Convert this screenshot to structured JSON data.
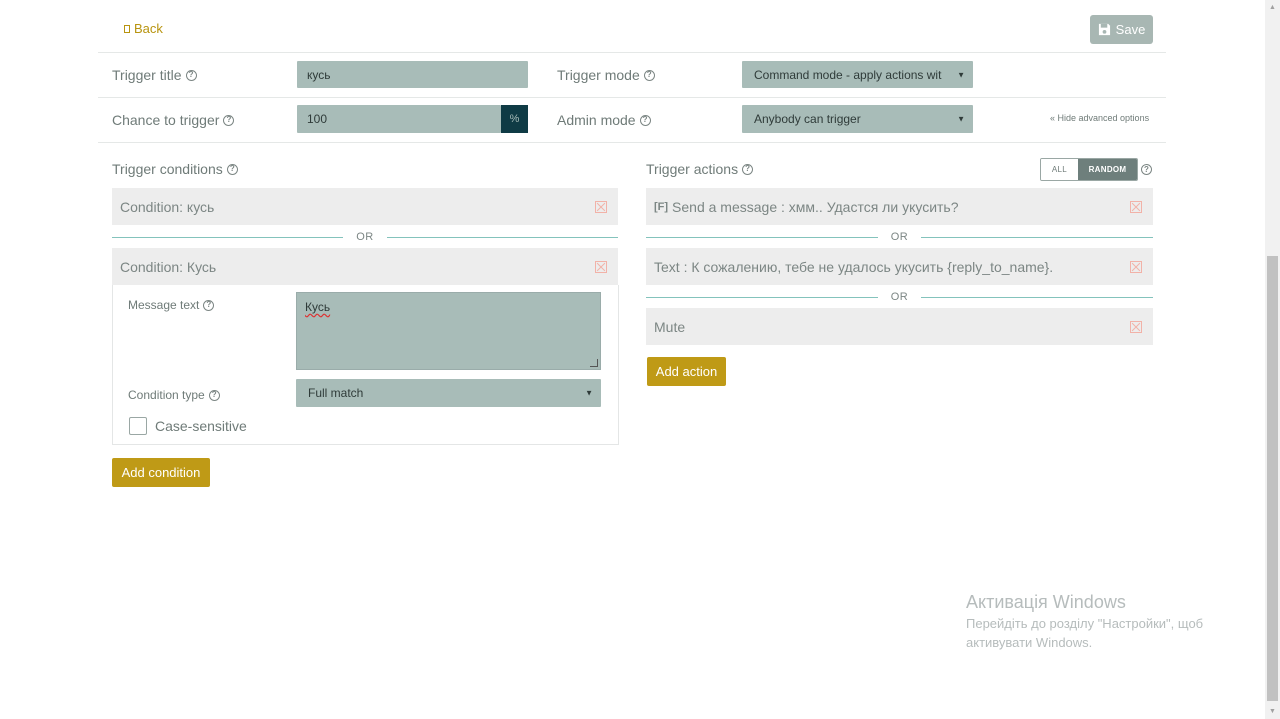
{
  "toolbar": {
    "back_label": "Back",
    "save_label": "Save"
  },
  "settings": {
    "trigger_title_label": "Trigger title",
    "trigger_title_value": "кусь",
    "chance_label": "Chance to trigger",
    "chance_value": "100",
    "chance_unit": "%",
    "trigger_mode_label": "Trigger mode",
    "trigger_mode_value": "Command mode - apply actions wit",
    "admin_mode_label": "Admin mode",
    "admin_mode_value": "Anybody can trigger",
    "hide_advanced": "« Hide advanced options"
  },
  "conditions": {
    "title": "Trigger conditions",
    "or_label": "OR",
    "items": [
      {
        "label": "Condition: кусь"
      },
      {
        "label": "Condition: Кусь"
      }
    ],
    "expanded": {
      "message_text_label": "Message text",
      "message_text_value": "Кусь",
      "condition_type_label": "Condition type",
      "condition_type_value": "Full match",
      "case_sensitive_label": "Case-sensitive"
    },
    "add_button": "Add condition"
  },
  "actions": {
    "title": "Trigger actions",
    "mode_all": "ALL",
    "mode_random": "RANDOM",
    "or_label": "OR",
    "items": [
      {
        "prefix": "[F]",
        "label": "Send a message : хмм.. Удастся ли укусить?"
      },
      {
        "label": "Text : К сожалению, тебе не удалось укусить {reply_to_name}."
      },
      {
        "label": "Mute"
      }
    ],
    "add_button": "Add action"
  },
  "windows_notice": {
    "title": "Активація Windows",
    "line1": "Перейдіть до розділу \"Настройки\", щоб",
    "line2": "активувати Windows."
  },
  "icons": {
    "help": "question-circle-icon",
    "remove": "remove-x-icon",
    "save": "floppy-disk-icon"
  },
  "colors": {
    "accent_gold": "#bf9a16",
    "field_bg": "#a8bcb8",
    "dark_teal": "#0f3b45",
    "separator_teal": "#84c3bc",
    "remove_red": "#f2b2a8"
  }
}
